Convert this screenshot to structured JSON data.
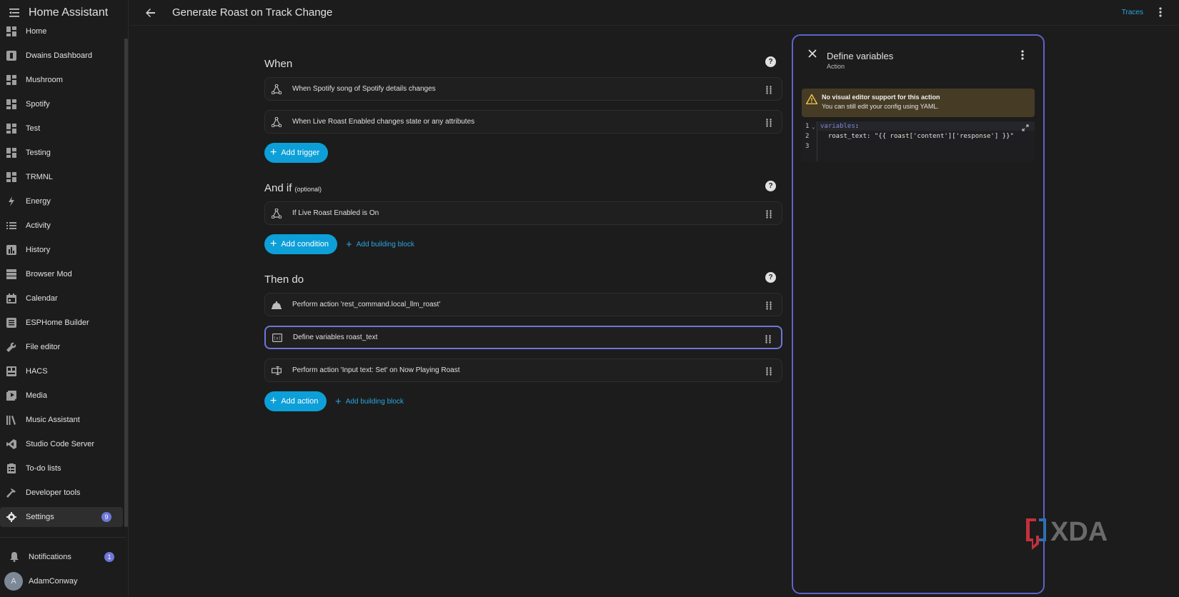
{
  "app": {
    "title": "Home Assistant"
  },
  "topbar": {
    "title": "Generate Roast on Track Change",
    "traces": "Traces"
  },
  "sidebar": {
    "items": [
      {
        "label": "Home",
        "icon": "dashboard-icon"
      },
      {
        "label": "Dwains Dashboard",
        "icon": "dashboard-square-icon"
      },
      {
        "label": "Mushroom",
        "icon": "dashboard-icon"
      },
      {
        "label": "Spotify",
        "icon": "dashboard-icon"
      },
      {
        "label": "Test",
        "icon": "dashboard-icon"
      },
      {
        "label": "Testing",
        "icon": "dashboard-icon"
      },
      {
        "label": "TRMNL",
        "icon": "dashboard-icon"
      },
      {
        "label": "Energy",
        "icon": "lightning-icon"
      },
      {
        "label": "Activity",
        "icon": "list-icon"
      },
      {
        "label": "History",
        "icon": "chart-box-icon"
      },
      {
        "label": "Browser Mod",
        "icon": "server-icon"
      },
      {
        "label": "Calendar",
        "icon": "calendar-icon"
      },
      {
        "label": "ESPHome Builder",
        "icon": "esphome-icon"
      },
      {
        "label": "File editor",
        "icon": "wrench-icon"
      },
      {
        "label": "HACS",
        "icon": "hacs-icon"
      },
      {
        "label": "Media",
        "icon": "media-icon"
      },
      {
        "label": "Music Assistant",
        "icon": "music-library-icon"
      },
      {
        "label": "Studio Code Server",
        "icon": "vscode-icon"
      },
      {
        "label": "To-do lists",
        "icon": "clipboard-list-icon"
      },
      {
        "label": "Developer tools",
        "icon": "hammer-icon"
      },
      {
        "label": "Settings",
        "icon": "gear-icon",
        "badge": "9"
      }
    ],
    "notifications": {
      "label": "Notifications",
      "badge": "1"
    },
    "user": {
      "name": "AdamConway",
      "initial": "A"
    }
  },
  "editor": {
    "when": {
      "title": "When",
      "rows": [
        "When Spotify song of Spotify details changes",
        "When Live Roast Enabled changes state or any attributes"
      ],
      "add_trigger": "Add trigger"
    },
    "and_if": {
      "title": "And if",
      "optional": "(optional)",
      "rows": [
        "If Live Roast Enabled is On"
      ],
      "add_condition": "Add condition",
      "add_building_block": "Add building block"
    },
    "then_do": {
      "title": "Then do",
      "rows": [
        "Perform action 'rest_command.local_llm_roast'",
        "Define variables roast_text",
        "Perform action 'Input text: Set' on Now Playing Roast"
      ],
      "add_action": "Add action",
      "add_building_block": "Add building block"
    }
  },
  "panel": {
    "title": "Define variables",
    "subtitle": "Action",
    "warning_title": "No visual editor support for this action",
    "warning_body": "You can still edit your config using YAML.",
    "code": {
      "line_numbers": [
        "1",
        "2",
        "3"
      ],
      "line1_key": "variables",
      "line1_colon": ":",
      "line2": "  roast_text: \"{{ roast['content']['response'] }}\""
    }
  },
  "watermark": {
    "text": "XDA"
  },
  "colors": {
    "accent": "#0d9fd8",
    "selection": "#6e76d8",
    "link": "#2aa6df",
    "warning_bg": "#463c26"
  }
}
